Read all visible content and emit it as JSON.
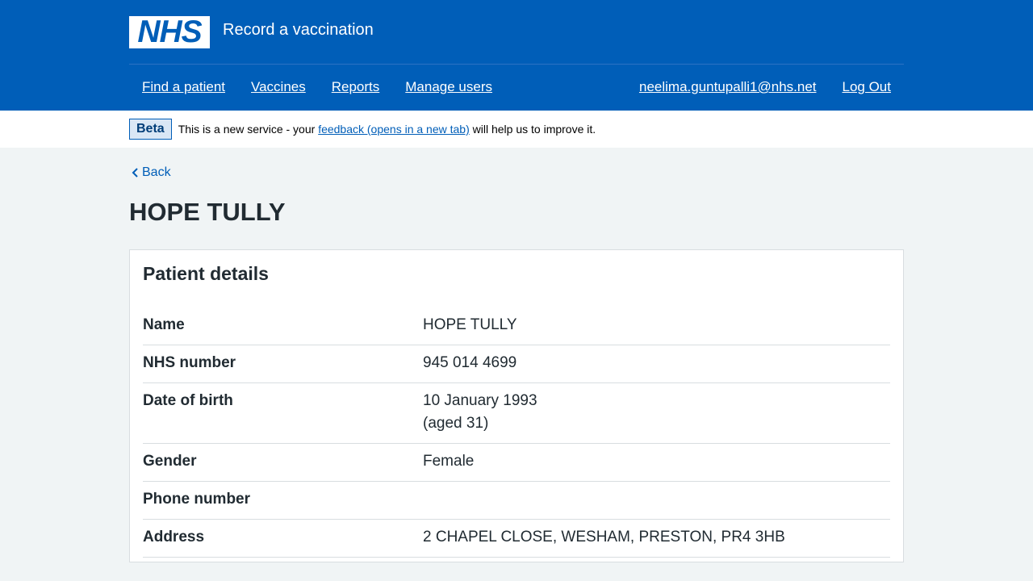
{
  "header": {
    "logo_text": "NHS",
    "service_name": "Record a vaccination",
    "nav": [
      {
        "label": "Find a patient"
      },
      {
        "label": "Vaccines"
      },
      {
        "label": "Reports"
      },
      {
        "label": "Manage users"
      }
    ],
    "user_email": "neelima.guntupalli1@nhs.net",
    "logout_label": "Log Out"
  },
  "beta": {
    "tag": "Beta",
    "text_before": "This is a new service - your ",
    "link_text": "feedback (opens in a new tab)",
    "text_after": " will help us to improve it."
  },
  "back_label": "Back",
  "page_title": "HOPE TULLY",
  "card": {
    "title": "Patient details",
    "rows": [
      {
        "key": "Name",
        "value": "HOPE TULLY",
        "value2": ""
      },
      {
        "key": "NHS number",
        "value": "945 014 4699",
        "value2": ""
      },
      {
        "key": "Date of birth",
        "value": "10 January 1993",
        "value2": "(aged 31)"
      },
      {
        "key": "Gender",
        "value": "Female",
        "value2": ""
      },
      {
        "key": "Phone number",
        "value": "",
        "value2": ""
      },
      {
        "key": "Address",
        "value": "2 CHAPEL CLOSE, WESHAM, PRESTON, PR4 3HB",
        "value2": ""
      }
    ]
  },
  "colors": {
    "brand": "#005eb8",
    "background": "#f0f4f5",
    "text": "#212b32"
  }
}
